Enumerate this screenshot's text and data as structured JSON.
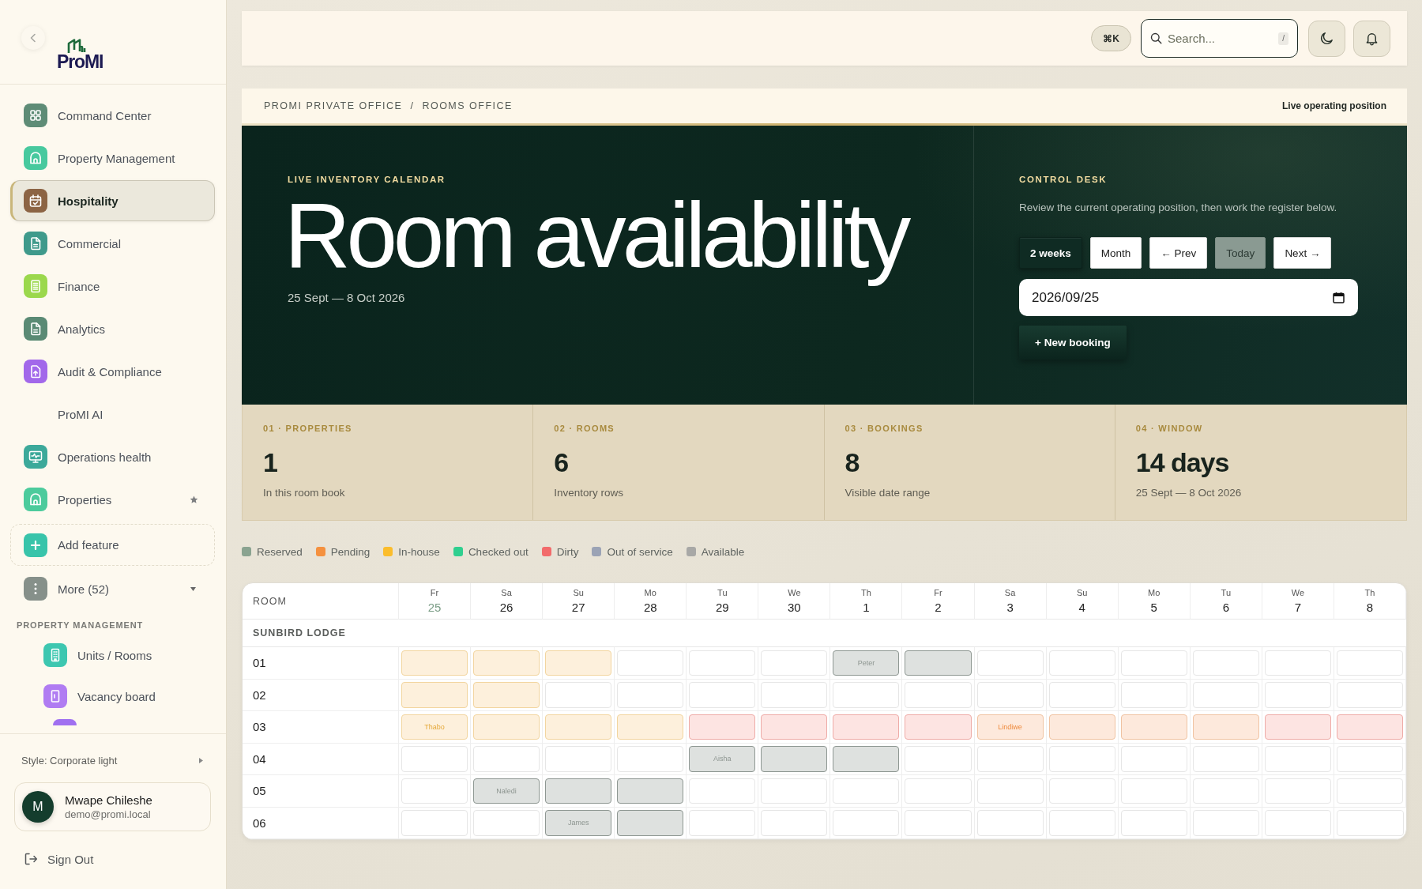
{
  "sidebar": {
    "logo": {
      "text": "ProMI"
    },
    "nav": [
      {
        "label": "Command Center",
        "color": "#5e8c76",
        "selected": false,
        "pinned": false
      },
      {
        "label": "Property Management",
        "color": "#47c99e",
        "selected": false,
        "pinned": false
      },
      {
        "label": "Hospitality",
        "color": "#8c6444",
        "selected": true,
        "pinned": false
      },
      {
        "label": "Commercial",
        "color": "#3f9a8b",
        "selected": false,
        "pinned": false
      },
      {
        "label": "Finance",
        "color": "#9bd84c",
        "selected": false,
        "pinned": false
      },
      {
        "label": "Analytics",
        "color": "#5a8a74",
        "selected": false,
        "pinned": false
      },
      {
        "label": "Audit & Compliance",
        "color": "#a268ea",
        "selected": false,
        "pinned": false
      },
      {
        "label": "ProMI AI",
        "selected": false,
        "pinned": false
      },
      {
        "label": "Operations health",
        "color": "#3ca99a",
        "selected": false,
        "pinned": false
      },
      {
        "label": "Properties",
        "color": "#4ccb9c",
        "selected": false,
        "pinned": true
      }
    ],
    "add_feature": {
      "label": "Add feature"
    },
    "more": {
      "label": "More (52)"
    },
    "section": {
      "title": "PROPERTY MANAGEMENT",
      "items": [
        {
          "label": "Units / Rooms",
          "color": "#3dc7b0"
        },
        {
          "label": "Vacancy board",
          "color": "#b07cf2"
        },
        {
          "color": "#a070f0"
        }
      ]
    },
    "style_switch": {
      "label": "Style: Corporate light"
    },
    "user": {
      "initial": "M",
      "name": "Mwape Chileshe",
      "email": "demo@promi.local"
    },
    "sign_out": {
      "label": "Sign Out"
    }
  },
  "topbar": {
    "shortcut": "⌘K",
    "search": {
      "placeholder": "Search...",
      "key": "/"
    }
  },
  "breadcrumb": {
    "items": [
      "PROMI PRIVATE OFFICE",
      "ROOMS OFFICE"
    ],
    "separator": "/",
    "status": "Live operating position"
  },
  "hero": {
    "eyebrow": "LIVE INVENTORY CALENDAR",
    "title": "Room availability",
    "date_range": "25 Sept — 8 Oct 2026"
  },
  "control_desk": {
    "eyebrow": "CONTROL DESK",
    "description": "Review the current operating position, then work the register below.",
    "view_modes": [
      {
        "label": "2 weeks",
        "selected": true
      },
      {
        "label": "Month",
        "selected": false
      }
    ],
    "nav_buttons": [
      {
        "label": "← Prev",
        "disabled": false
      },
      {
        "label": "Today",
        "disabled": true
      },
      {
        "label": "Next →",
        "disabled": false
      }
    ],
    "date_field": {
      "value": "2026/09/25"
    },
    "new_booking": {
      "label": "+ New booking"
    }
  },
  "stats": [
    {
      "label": "01 · PROPERTIES",
      "value": "1",
      "caption": "In this room book"
    },
    {
      "label": "02 · ROOMS",
      "value": "6",
      "caption": "Inventory rows"
    },
    {
      "label": "03 · BOOKINGS",
      "value": "8",
      "caption": "Visible date range"
    },
    {
      "label": "04 · WINDOW",
      "value": "14 days",
      "caption": "25 Sept — 8 Oct 2026"
    }
  ],
  "legend": [
    {
      "label": "Reserved",
      "color": "#8aa390"
    },
    {
      "label": "Pending",
      "color": "#f5913f"
    },
    {
      "label": "In-house",
      "color": "#fbbd2c"
    },
    {
      "label": "Checked out",
      "color": "#2fcf8f"
    },
    {
      "label": "Dirty",
      "color": "#f26b6b"
    },
    {
      "label": "Out of service",
      "color": "#9ba3b5"
    },
    {
      "label": "Available",
      "color": "#a8a8a6"
    }
  ],
  "calendar": {
    "room_header": "ROOM",
    "days": [
      {
        "weekday": "Fr",
        "date": "25",
        "today": true
      },
      {
        "weekday": "Sa",
        "date": "26",
        "today": false
      },
      {
        "weekday": "Su",
        "date": "27",
        "today": false
      },
      {
        "weekday": "Mo",
        "date": "28",
        "today": false
      },
      {
        "weekday": "Tu",
        "date": "29",
        "today": false
      },
      {
        "weekday": "We",
        "date": "30",
        "today": false
      },
      {
        "weekday": "Th",
        "date": "1",
        "today": false
      },
      {
        "weekday": "Fr",
        "date": "2",
        "today": false
      },
      {
        "weekday": "Sa",
        "date": "3",
        "today": false
      },
      {
        "weekday": "Su",
        "date": "4",
        "today": false
      },
      {
        "weekday": "Mo",
        "date": "5",
        "today": false
      },
      {
        "weekday": "Tu",
        "date": "6",
        "today": false
      },
      {
        "weekday": "We",
        "date": "7",
        "today": false
      },
      {
        "weekday": "Th",
        "date": "8",
        "today": false
      }
    ],
    "groups": [
      {
        "name": "SUNBIRD LODGE",
        "rooms": [
          {
            "room": "01",
            "cells": [
              {
                "kind": "in_house"
              },
              {
                "kind": "in_house"
              },
              {
                "kind": "in_house"
              },
              {
                "kind": "available"
              },
              {
                "kind": "available"
              },
              {
                "kind": "available"
              },
              {
                "kind": "reserved",
                "guest": "Peter"
              },
              {
                "kind": "reserved"
              },
              {
                "kind": "available"
              },
              {
                "kind": "available"
              },
              {
                "kind": "available"
              },
              {
                "kind": "available"
              },
              {
                "kind": "available"
              },
              {
                "kind": "available"
              }
            ]
          },
          {
            "room": "02",
            "cells": [
              {
                "kind": "in_house"
              },
              {
                "kind": "in_house"
              },
              {
                "kind": "available"
              },
              {
                "kind": "available"
              },
              {
                "kind": "available"
              },
              {
                "kind": "available"
              },
              {
                "kind": "available"
              },
              {
                "kind": "available"
              },
              {
                "kind": "available"
              },
              {
                "kind": "available"
              },
              {
                "kind": "available"
              },
              {
                "kind": "available"
              },
              {
                "kind": "available"
              },
              {
                "kind": "available"
              }
            ]
          },
          {
            "room": "03",
            "cells": [
              {
                "kind": "in_house",
                "guest": "Thabo"
              },
              {
                "kind": "in_house"
              },
              {
                "kind": "in_house"
              },
              {
                "kind": "in_house"
              },
              {
                "kind": "dirty"
              },
              {
                "kind": "dirty"
              },
              {
                "kind": "dirty"
              },
              {
                "kind": "dirty"
              },
              {
                "kind": "pending",
                "guest": "Lindiwe"
              },
              {
                "kind": "pending"
              },
              {
                "kind": "pending"
              },
              {
                "kind": "pending"
              },
              {
                "kind": "dirty"
              },
              {
                "kind": "dirty"
              }
            ]
          },
          {
            "room": "04",
            "cells": [
              {
                "kind": "available"
              },
              {
                "kind": "available"
              },
              {
                "kind": "available"
              },
              {
                "kind": "available"
              },
              {
                "kind": "reserved",
                "guest": "Aisha"
              },
              {
                "kind": "reserved"
              },
              {
                "kind": "reserved"
              },
              {
                "kind": "available"
              },
              {
                "kind": "available"
              },
              {
                "kind": "available"
              },
              {
                "kind": "available"
              },
              {
                "kind": "available"
              },
              {
                "kind": "available"
              },
              {
                "kind": "available"
              }
            ]
          },
          {
            "room": "05",
            "cells": [
              {
                "kind": "available"
              },
              {
                "kind": "reserved",
                "guest": "Naledi"
              },
              {
                "kind": "reserved"
              },
              {
                "kind": "reserved"
              },
              {
                "kind": "available"
              },
              {
                "kind": "available"
              },
              {
                "kind": "available"
              },
              {
                "kind": "available"
              },
              {
                "kind": "available"
              },
              {
                "kind": "available"
              },
              {
                "kind": "available"
              },
              {
                "kind": "available"
              },
              {
                "kind": "available"
              },
              {
                "kind": "available"
              }
            ]
          },
          {
            "room": "06",
            "cells": [
              {
                "kind": "available"
              },
              {
                "kind": "available"
              },
              {
                "kind": "reserved",
                "guest": "James"
              },
              {
                "kind": "reserved"
              },
              {
                "kind": "available"
              },
              {
                "kind": "available"
              },
              {
                "kind": "available"
              },
              {
                "kind": "available"
              },
              {
                "kind": "available"
              },
              {
                "kind": "available"
              },
              {
                "kind": "available"
              },
              {
                "kind": "available"
              },
              {
                "kind": "available"
              },
              {
                "kind": "available"
              }
            ]
          }
        ]
      }
    ]
  }
}
